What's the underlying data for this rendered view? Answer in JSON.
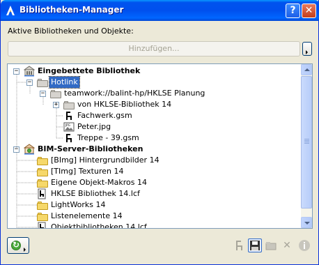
{
  "window": {
    "title": "Bibliotheken-Manager",
    "help_label": "?",
    "close_label": "✕"
  },
  "section_label": "Aktive Bibliotheken und Objekte:",
  "add_button_label": "Hinzufügen...",
  "tree": {
    "embedded_root": "Eingebettete Bibliothek",
    "hotlink": "Hotlink",
    "teamwork": "teamwork://balint-hp/HKLSE Planung",
    "von_hklse": "von HKLSE-Bibliothek 14",
    "fachwerk": "Fachwerk.gsm",
    "peter": "Peter.jpg",
    "treppe": "Treppe - 39.gsm",
    "bim_root": "BIM-Server-Bibliotheken",
    "items": [
      "[BImg] Hintergrundbilder 14",
      "[TImg] Texturen 14",
      "Eigene Objekt-Makros 14",
      "HKLSE Bibliothek 14.lcf",
      "LightWorks 14",
      "Listenelemente 14",
      "Objektbibliotheken 14.lcf"
    ]
  },
  "colors": {
    "title_gradient_mid": "#0050ee",
    "selection": "#316ac5",
    "close_button": "#c43d1b"
  }
}
